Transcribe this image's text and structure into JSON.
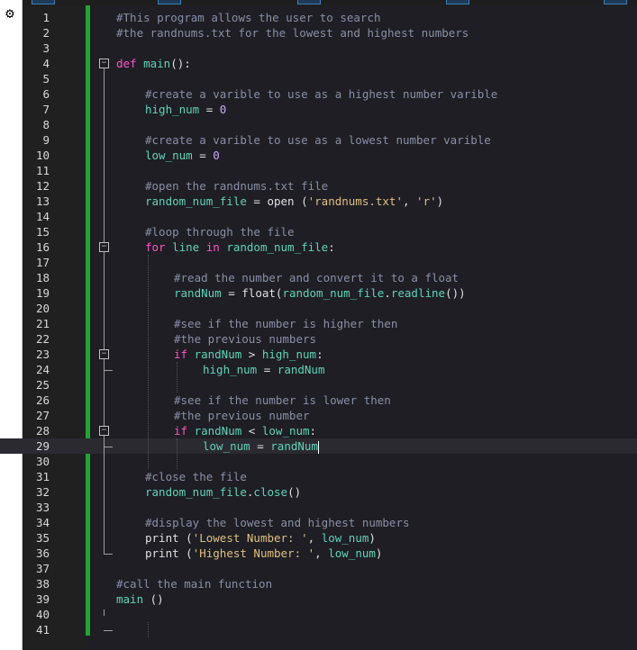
{
  "editor": {
    "lines": [
      {
        "n": "1",
        "tokens": [
          [
            "cmt",
            "#This program allows the user to search"
          ]
        ],
        "indent": 0
      },
      {
        "n": "2",
        "tokens": [
          [
            "cmt",
            "#the randnums.txt for the lowest and highest numbers"
          ]
        ],
        "indent": 0
      },
      {
        "n": "3",
        "tokens": [],
        "indent": 0
      },
      {
        "n": "4",
        "tokens": [
          [
            "kw",
            "def "
          ],
          [
            "fn",
            "main"
          ],
          [
            "op",
            "():"
          ]
        ],
        "indent": 0
      },
      {
        "n": "5",
        "tokens": [],
        "indent": 0
      },
      {
        "n": "6",
        "tokens": [
          [
            "cmt",
            "#create a varible to use as a highest number varible"
          ]
        ],
        "indent": 1
      },
      {
        "n": "7",
        "tokens": [
          [
            "fn",
            "high_num"
          ],
          [
            "op",
            " = "
          ],
          [
            "num",
            "0"
          ]
        ],
        "indent": 1
      },
      {
        "n": "8",
        "tokens": [],
        "indent": 0
      },
      {
        "n": "9",
        "tokens": [
          [
            "cmt",
            "#create a varible to use as a lowest number varible"
          ]
        ],
        "indent": 1
      },
      {
        "n": "10",
        "tokens": [
          [
            "fn",
            "low_num"
          ],
          [
            "op",
            " = "
          ],
          [
            "num",
            "0"
          ]
        ],
        "indent": 1
      },
      {
        "n": "11",
        "tokens": [],
        "indent": 0
      },
      {
        "n": "12",
        "tokens": [
          [
            "cmt",
            "#open the randnums.txt file"
          ]
        ],
        "indent": 1
      },
      {
        "n": "13",
        "tokens": [
          [
            "fn",
            "random_num_file"
          ],
          [
            "op",
            " = open ("
          ],
          [
            "str",
            "'randnums.txt'"
          ],
          [
            "op",
            ", "
          ],
          [
            "str",
            "'r'"
          ],
          [
            "op",
            ")"
          ]
        ],
        "indent": 1
      },
      {
        "n": "14",
        "tokens": [],
        "indent": 0
      },
      {
        "n": "15",
        "tokens": [
          [
            "cmt",
            "#loop through the file"
          ]
        ],
        "indent": 1
      },
      {
        "n": "16",
        "tokens": [
          [
            "kw",
            "for "
          ],
          [
            "fn",
            "line"
          ],
          [
            "kw",
            " in "
          ],
          [
            "fn",
            "random_num_file"
          ],
          [
            "op",
            ":"
          ]
        ],
        "indent": 1
      },
      {
        "n": "17",
        "tokens": [],
        "indent": 0
      },
      {
        "n": "18",
        "tokens": [
          [
            "cmt",
            "#read the number and convert it to a float"
          ]
        ],
        "indent": 2
      },
      {
        "n": "19",
        "tokens": [
          [
            "fn",
            "randNum"
          ],
          [
            "op",
            " = float("
          ],
          [
            "fn",
            "random_num_file"
          ],
          [
            "op",
            "."
          ],
          [
            "fn",
            "readline"
          ],
          [
            "op",
            "())"
          ]
        ],
        "indent": 2
      },
      {
        "n": "20",
        "tokens": [],
        "indent": 0
      },
      {
        "n": "21",
        "tokens": [
          [
            "cmt",
            "#see if the number is higher then"
          ]
        ],
        "indent": 2
      },
      {
        "n": "22",
        "tokens": [
          [
            "cmt",
            "#the previous numbers"
          ]
        ],
        "indent": 2
      },
      {
        "n": "23",
        "tokens": [
          [
            "kw",
            "if "
          ],
          [
            "fn",
            "randNum"
          ],
          [
            "op",
            " > "
          ],
          [
            "fn",
            "high_num"
          ],
          [
            "op",
            ":"
          ]
        ],
        "indent": 2
      },
      {
        "n": "24",
        "tokens": [
          [
            "fn",
            "high_num"
          ],
          [
            "op",
            " = "
          ],
          [
            "fn",
            "randNum"
          ]
        ],
        "indent": 3
      },
      {
        "n": "25",
        "tokens": [],
        "indent": 0
      },
      {
        "n": "26",
        "tokens": [
          [
            "cmt",
            "#see if the number is lower then"
          ]
        ],
        "indent": 2
      },
      {
        "n": "27",
        "tokens": [
          [
            "cmt",
            "#the previous number"
          ]
        ],
        "indent": 2
      },
      {
        "n": "28",
        "tokens": [
          [
            "kw",
            "if "
          ],
          [
            "fn",
            "randNum"
          ],
          [
            "op",
            " < "
          ],
          [
            "fn",
            "low_num"
          ],
          [
            "op",
            ":"
          ]
        ],
        "indent": 2
      },
      {
        "n": "29",
        "tokens": [
          [
            "fn",
            "low_num"
          ],
          [
            "op",
            " = "
          ],
          [
            "fn",
            "randNum"
          ]
        ],
        "indent": 3,
        "current": true
      },
      {
        "n": "30",
        "tokens": [],
        "indent": 0
      },
      {
        "n": "31",
        "tokens": [
          [
            "cmt",
            "#close the file"
          ]
        ],
        "indent": 1
      },
      {
        "n": "32",
        "tokens": [
          [
            "fn",
            "random_num_file"
          ],
          [
            "op",
            "."
          ],
          [
            "fn",
            "close"
          ],
          [
            "op",
            "()"
          ]
        ],
        "indent": 1
      },
      {
        "n": "33",
        "tokens": [],
        "indent": 0
      },
      {
        "n": "34",
        "tokens": [
          [
            "cmt",
            "#display the lowest and highest numbers"
          ]
        ],
        "indent": 1
      },
      {
        "n": "35",
        "tokens": [
          [
            "op",
            "print ("
          ],
          [
            "str",
            "'Lowest Number: '"
          ],
          [
            "op",
            ", "
          ],
          [
            "fn",
            "low_num"
          ],
          [
            "op",
            ")"
          ]
        ],
        "indent": 1
      },
      {
        "n": "36",
        "tokens": [
          [
            "op",
            "print ("
          ],
          [
            "str",
            "'Highest Number: '"
          ],
          [
            "op",
            ", "
          ],
          [
            "fn",
            "low_num"
          ],
          [
            "op",
            ")"
          ]
        ],
        "indent": 1
      },
      {
        "n": "37",
        "tokens": [],
        "indent": 0
      },
      {
        "n": "38",
        "tokens": [
          [
            "cmt",
            "#call the main function"
          ]
        ],
        "indent": 0
      },
      {
        "n": "39",
        "tokens": [
          [
            "fn",
            "main"
          ],
          [
            "op",
            " ()"
          ]
        ],
        "indent": 0
      },
      {
        "n": "40",
        "tokens": [],
        "indent": 0
      },
      {
        "n": "41",
        "tokens": [],
        "indent": 0
      }
    ]
  },
  "colors": {
    "background": "#1e1e24",
    "change_bar": "#22a52f",
    "keyword": "#ff55c8",
    "identifier": "#5fd4b8",
    "comment": "#8a8fa8",
    "string": "#e0c080",
    "number": "#cba6f7"
  },
  "icons": {
    "left_strip": "gear-icon",
    "fold_markers": "collapse-box-icon"
  }
}
